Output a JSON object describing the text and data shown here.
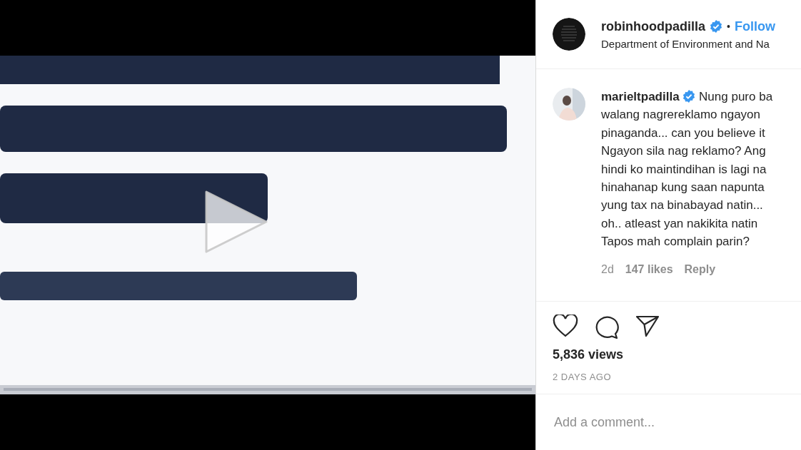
{
  "video": {
    "kind": "picture",
    "playable": true
  },
  "header": {
    "username": "robinhoodpadilla",
    "verified": true,
    "separator": "•",
    "follow": "Follow",
    "location": "Department of Environment and Na"
  },
  "comments": [
    {
      "username": "marieltpadilla",
      "verified": true,
      "lines": [
        "Nung puro ba",
        "walang nagrereklamo ngayon",
        "pinaganda... can you believe it",
        "Ngayon sila nag reklamo? Ang",
        "hindi ko maintindihan is lagi na",
        "hinahanap kung saan napunta",
        "yung tax na binabayad natin...",
        "oh.. atleast yan nakikita natin",
        "Tapos mah complain parin?"
      ],
      "time": "2d",
      "likes": "147 likes",
      "reply": "Reply"
    }
  ],
  "liked": false,
  "views": "5,836 views",
  "date": "2 DAYS AGO",
  "comment_field": {
    "placeholder": "Add a comment..."
  }
}
